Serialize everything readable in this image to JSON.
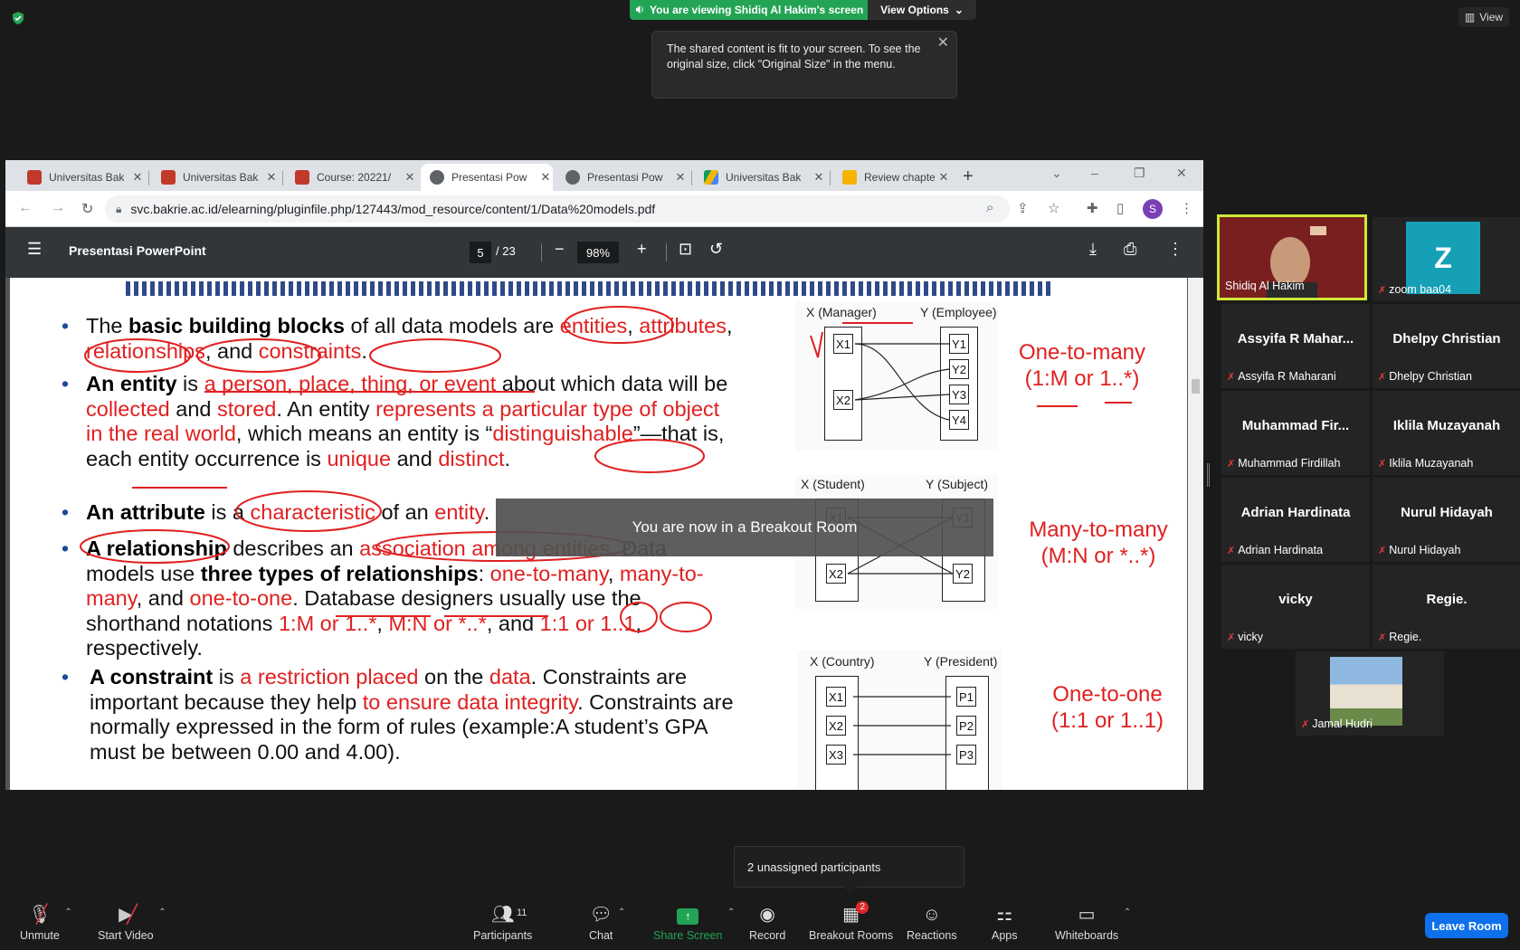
{
  "zoom": {
    "banner": "You are viewing Shidiq Al Hakim's screen",
    "view_options": "View Options",
    "view_button": "View",
    "tooltip_text": "The shared content is fit to your screen. To see the original size, click \"Original Size\" in the menu.",
    "breakout_msg": "You are now in a Breakout Room",
    "unassigned": "2 unassigned participants",
    "leave": "Leave Room",
    "toolbar": {
      "unmute": "Unmute",
      "start_video": "Start Video",
      "participants": "Participants",
      "participants_count": "11",
      "chat": "Chat",
      "share": "Share Screen",
      "record": "Record",
      "breakout": "Breakout Rooms",
      "breakout_badge": "2",
      "reactions": "Reactions",
      "apps": "Apps",
      "whiteboards": "Whiteboards"
    },
    "participants": [
      {
        "name": "Shidiq Al Hakim"
      },
      {
        "name": "zoom baa04",
        "initial": "Z"
      },
      {
        "big": "Assyifa R Mahar...",
        "name": "Assyifa R Maharani"
      },
      {
        "big": "Dhelpy Christian",
        "name": "Dhelpy Christian"
      },
      {
        "big": "Muhammad Fir...",
        "name": "Muhammad Firdillah"
      },
      {
        "big": "Iklila Muzayanah",
        "name": "Iklila Muzayanah"
      },
      {
        "big": "Adrian Hardinata",
        "name": "Adrian Hardinata"
      },
      {
        "big": "Nurul Hidayah",
        "name": "Nurul Hidayah"
      },
      {
        "big": "vicky",
        "name": "vicky"
      },
      {
        "big": "Regie.",
        "name": "Regie."
      },
      {
        "name": "Jamal Hudri"
      }
    ]
  },
  "browser": {
    "tabs": [
      {
        "title": "Universitas Bak"
      },
      {
        "title": "Universitas Bak"
      },
      {
        "title": "Course: 20221/"
      },
      {
        "title": "Presentasi Pow"
      },
      {
        "title": "Presentasi Pow"
      },
      {
        "title": "Universitas Bak"
      },
      {
        "title": "Review chapte"
      }
    ],
    "url": "svc.bakrie.ac.id/elearning/pluginfile.php/127443/mod_resource/content/1/Data%20models.pdf",
    "profile_initial": "S",
    "pdf": {
      "title": "Presentasi PowerPoint",
      "page": "5",
      "total": "/ 23",
      "zoom": "98%"
    }
  },
  "slide": {
    "p1": {
      "a": "The ",
      "b": "basic building blocks",
      "c": " of all data models are ",
      "r1": "entities",
      "d": ", ",
      "r2": "attributes",
      "e": ", ",
      "r3": "relationships",
      "f": ", and ",
      "r4": "constraints",
      "g": "."
    },
    "p2": {
      "b": "An entity",
      "a": " is ",
      "r1": "a person, place, thing, or event",
      "c": " about which data will be ",
      "r2": "collected",
      "d": " and ",
      "r3": "stored",
      "e": ". An entity ",
      "r4": "represents a particular type of object in the real world",
      "f": ", which means an entity is “",
      "r5": "distinguishable",
      "g": "”—that is, each entity occurrence is ",
      "r6": "unique",
      "h": " and ",
      "r7": "distinct",
      "i": "."
    },
    "p3": {
      "b": "An attribute",
      "a": " is a ",
      "r1": "characteristic",
      "c": " of an ",
      "r2": "entity",
      "d": "."
    },
    "p4": {
      "b1": "A relationship",
      "a": " describes an ",
      "r1": "association among entities",
      "c": ". Data models use ",
      "b2": "three types of relationships",
      "d": ": ",
      "r2": "one-to-many",
      "e": ", ",
      "r3": "many-to-many",
      "f": ", and ",
      "r4": "one-to-one",
      "g": ". Database designers usually use the shorthand notations ",
      "r5": "1:M or 1..*",
      "h": ", ",
      "r6": "M:N or *..*",
      "i": ", and ",
      "r7": "1:1 or 1..1",
      "j": ", respectively."
    },
    "p5": {
      "b": "A constraint",
      "a": " is ",
      "r1": "a restriction placed",
      "c": " on the ",
      "r2": "data",
      "d": ". Constraints are important because they help ",
      "r3": "to ensure data integrity",
      "e": ". Constraints are normally expressed in the form of rules (example:A student’s GPA must be between 0.00 and 4.00)."
    },
    "diagrams": {
      "d1": {
        "x_label": "X (Manager)",
        "y_label": "Y (Employee)",
        "x": [
          "X1",
          "X2"
        ],
        "y": [
          "Y1",
          "Y2",
          "Y3",
          "Y4"
        ]
      },
      "d2": {
        "x_label": "X (Student)",
        "y_label": "Y (Subject)",
        "x": [
          "X1",
          "X2"
        ],
        "y": [
          "Y1",
          "Y2"
        ]
      },
      "d3": {
        "x_label": "X (Country)",
        "y_label": "Y (President)",
        "x": [
          "X1",
          "X2",
          "X3"
        ],
        "y": [
          "P1",
          "P2",
          "P3"
        ]
      }
    },
    "annotations": {
      "one_to_many": "One-to-many",
      "one_to_many_note": "(1:M or 1..*)",
      "many_to_many": "Many-to-many",
      "many_to_many_note": "(M:N or *..*)",
      "one_to_one": "One-to-one",
      "one_to_one_note": "(1:1 or 1..1)"
    }
  },
  "colors": {
    "zoom_green": "#23a455",
    "leave_blue": "#0e71eb",
    "ink_red": "#e02020",
    "active_speaker": "#cfe83a"
  }
}
